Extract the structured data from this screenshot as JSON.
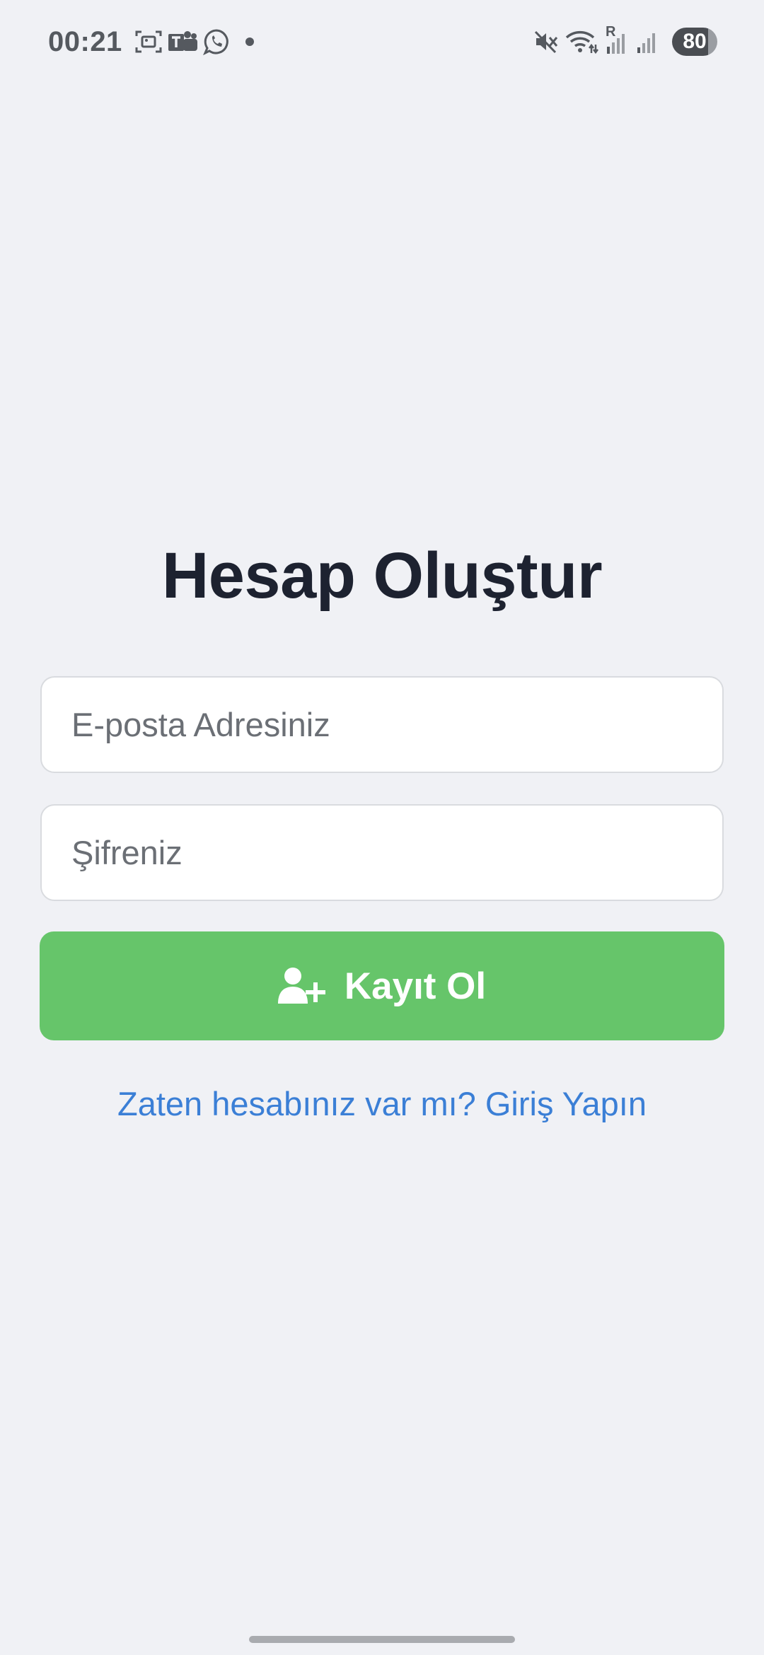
{
  "status_bar": {
    "time": "00:21",
    "left_icons": [
      "screenshot-icon",
      "teams-icon",
      "whatsapp-icon",
      "notification-dot-icon"
    ],
    "right_icons": [
      "mute-icon",
      "wifi-icon",
      "signal-roaming-icon",
      "signal-icon"
    ],
    "roaming_label": "R",
    "battery_level": "80"
  },
  "form": {
    "title": "Hesap Oluştur",
    "email_placeholder": "E-posta Adresiniz",
    "password_placeholder": "Şifreniz",
    "register_label": "Kayıt Ol",
    "register_icon": "user-plus-icon",
    "login_link": "Zaten hesabınız var mı? Giriş Yapın"
  },
  "colors": {
    "background": "#F0F1F5",
    "primary_button": "#66C56A",
    "link": "#3B7FD6",
    "title": "#1D2230"
  }
}
